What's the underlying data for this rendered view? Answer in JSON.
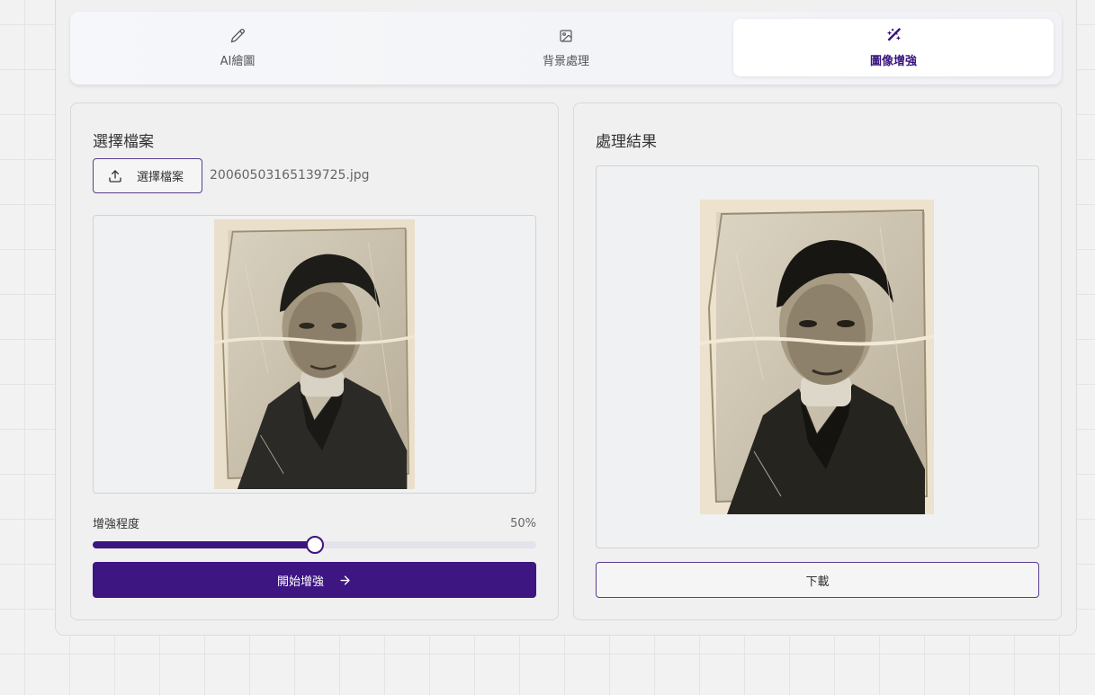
{
  "tabs": [
    {
      "label": "AI繪圖",
      "icon": "pencil-icon",
      "active": false
    },
    {
      "label": "背景處理",
      "icon": "image-icon",
      "active": false
    },
    {
      "label": "圖像增強",
      "icon": "magic-wand-icon",
      "active": true
    }
  ],
  "left_panel": {
    "title": "選擇檔案",
    "upload_button_label": "選擇檔案",
    "upload_icon": "upload-icon",
    "file_name": "20060503165139725.jpg",
    "slider": {
      "label": "增強程度",
      "value": 50,
      "value_text": "50%"
    },
    "start_button_label": "開始增強",
    "start_button_icon": "arrow-right-icon"
  },
  "right_panel": {
    "title": "處理結果",
    "download_button_label": "下載"
  },
  "colors": {
    "accent": "#3d1682",
    "accent_text": "#3b1580",
    "border": "#d9d9d9",
    "panel_bg": "#f0f0f0"
  }
}
